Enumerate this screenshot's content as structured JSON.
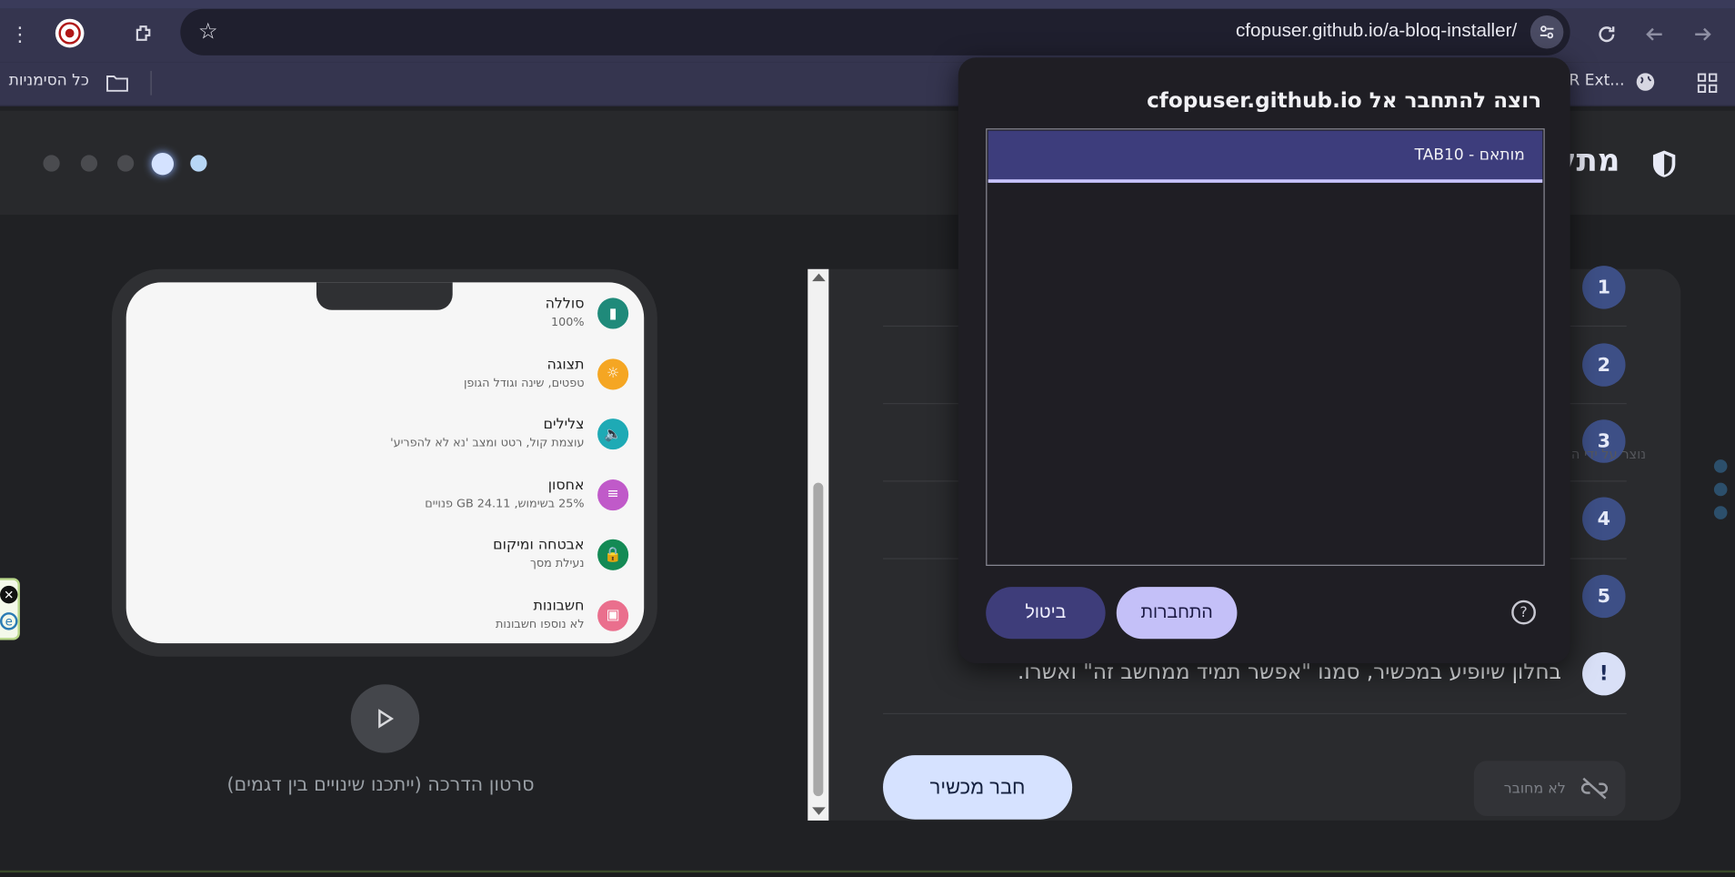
{
  "browser": {
    "url": "cfopuser.github.io/a-bloq-installer/",
    "bookmarks_folder": "כל הסימניות",
    "bookmark_ext": "R Ext..."
  },
  "header": {
    "brand": "מתק",
    "steps_total": 5,
    "current_step": 2
  },
  "phone": {
    "settings": [
      {
        "title": "סוללה",
        "subtitle": "100%",
        "icon": "battery-icon",
        "color": "#1f8a7a"
      },
      {
        "title": "תצוגה",
        "subtitle": "טפטים, שינה וגודל הגופן",
        "icon": "display-icon",
        "color": "#f5a623"
      },
      {
        "title": "צלילים",
        "subtitle": "עוצמת קול, רטט ומצב 'נא לא להפריע'",
        "icon": "sound-icon",
        "color": "#1eaab5"
      },
      {
        "title": "אחסון",
        "subtitle": "25% בשימוש, 24.11 GB פנויים",
        "icon": "storage-icon",
        "color": "#c05ac9"
      },
      {
        "title": "אבטחה ומיקום",
        "subtitle": "נעילת מסך",
        "icon": "lock-icon",
        "color": "#148a55"
      },
      {
        "title": "חשבונות",
        "subtitle": "לא נוספו חשבונות",
        "icon": "accounts-icon",
        "color": "#ea6f8d"
      }
    ],
    "caption": "סרטון הדרכה (ייתכנו שינויים בין דגמים)"
  },
  "steps": [
    "1",
    "2",
    "3",
    "4",
    "5"
  ],
  "warning_symbol": "!",
  "instruction": "בחלון שיופיע במכשיר, סמנו \"אפשר תמיד ממחשב זה\" ואשרו.",
  "faint_text": "נוצר על ידי ה",
  "connect_device_label": "חבר מכשיר",
  "status_label": "לא מחובר",
  "dialog": {
    "title": "רוצה להתחבר אל cfopuser.github.io",
    "devices": [
      "מותאם - TAB10"
    ],
    "cancel_label": "ביטול",
    "connect_label": "התחברות",
    "help_symbol": "?"
  }
}
